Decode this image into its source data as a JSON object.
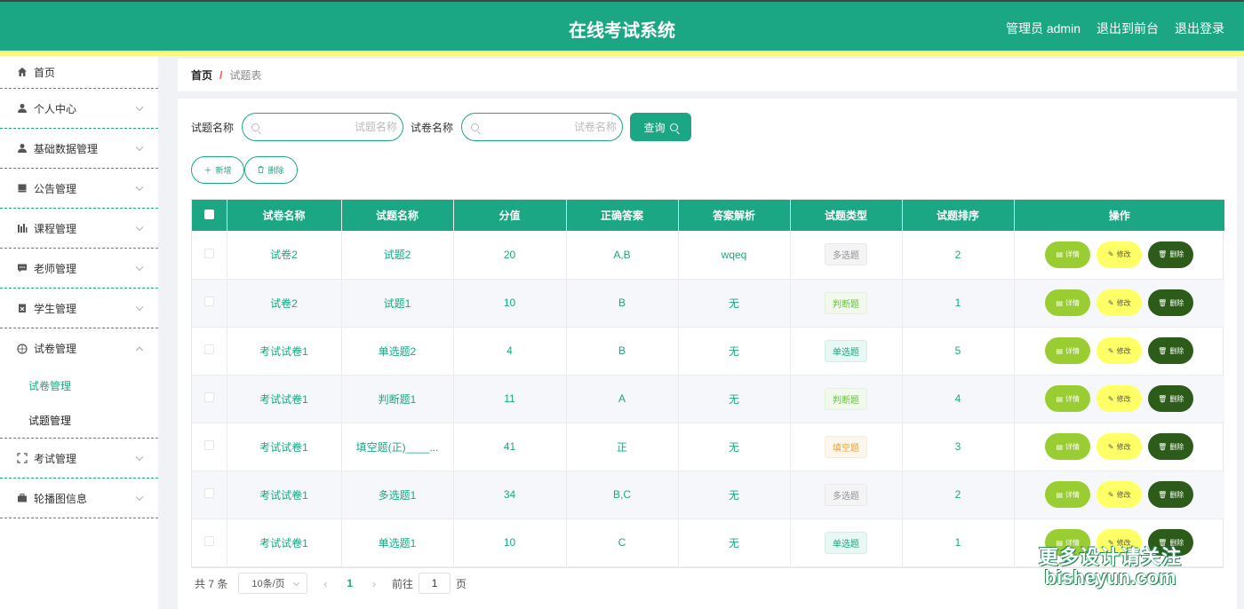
{
  "header": {
    "title": "在线考试系统",
    "admin_label": "管理员 admin",
    "front_label": "退出到前台",
    "logout_label": "退出登录"
  },
  "sidebar": {
    "items": [
      {
        "label": "首页",
        "icon": "home-icon"
      },
      {
        "label": "个人中心",
        "icon": "user-icon"
      },
      {
        "label": "基础数据管理",
        "icon": "user-icon"
      },
      {
        "label": "公告管理",
        "icon": "book-icon"
      },
      {
        "label": "课程管理",
        "icon": "chart-icon"
      },
      {
        "label": "老师管理",
        "icon": "message-icon"
      },
      {
        "label": "学生管理",
        "icon": "clipboard-icon"
      },
      {
        "label": "试卷管理",
        "icon": "compass-icon",
        "sub": [
          "试卷管理",
          "试题管理"
        ]
      },
      {
        "label": "考试管理",
        "icon": "frame-icon"
      },
      {
        "label": "轮播图信息",
        "icon": "briefcase-icon"
      }
    ]
  },
  "breadcrumb": {
    "home": "首页",
    "separator": "/",
    "current": "试题表"
  },
  "search": {
    "question_label": "试题名称",
    "question_placeholder": "试题名称",
    "paper_label": "试卷名称",
    "paper_placeholder": "试卷名称",
    "query_label": "查询"
  },
  "actions": {
    "add_label": "新增",
    "delete_label": "删除"
  },
  "table": {
    "headers": [
      "试卷名称",
      "试题名称",
      "分值",
      "正确答案",
      "答案解析",
      "试题类型",
      "试题排序",
      "操作"
    ],
    "rows": [
      {
        "paper": "试卷2",
        "question": "试题2",
        "score": "20",
        "answer": "A,B",
        "analysis": "wqeq",
        "type": "多选题",
        "type_class": "multi",
        "order": "2"
      },
      {
        "paper": "试卷2",
        "question": "试题1",
        "score": "10",
        "answer": "B",
        "analysis": "无",
        "type": "判断题",
        "type_class": "judge",
        "order": "1"
      },
      {
        "paper": "考试试卷1",
        "question": "单选题2",
        "score": "4",
        "answer": "B",
        "analysis": "无",
        "type": "单选题",
        "type_class": "single",
        "order": "5"
      },
      {
        "paper": "考试试卷1",
        "question": "判断题1",
        "score": "11",
        "answer": "A",
        "analysis": "无",
        "type": "判断题",
        "type_class": "judge",
        "order": "4"
      },
      {
        "paper": "考试试卷1",
        "question": "填空题(正)____...",
        "score": "41",
        "answer": "正",
        "analysis": "无",
        "type": "填空题",
        "type_class": "fill",
        "order": "3"
      },
      {
        "paper": "考试试卷1",
        "question": "多选题1",
        "score": "34",
        "answer": "B,C",
        "analysis": "无",
        "type": "多选题",
        "type_class": "multi",
        "order": "2"
      },
      {
        "paper": "考试试卷1",
        "question": "单选题1",
        "score": "10",
        "answer": "C",
        "analysis": "无",
        "type": "单选题",
        "type_class": "single",
        "order": "1"
      }
    ],
    "op_labels": {
      "detail": "详情",
      "edit": "修改",
      "delete": "删除"
    }
  },
  "pagination": {
    "total": "共 7 条",
    "page_size": "10条/页",
    "current_page": "1",
    "goto_label": "前往",
    "goto_value": "1",
    "page_unit": "页"
  },
  "watermark": {
    "line1": "更多设计请关注",
    "line2": "bisheyun.com"
  },
  "colors": {
    "primary": "#1ba784",
    "accent_bar": "#f8f97a",
    "detail_btn": "#9acd32",
    "edit_btn": "#ffff66",
    "delete_btn": "#2c5b1a"
  }
}
